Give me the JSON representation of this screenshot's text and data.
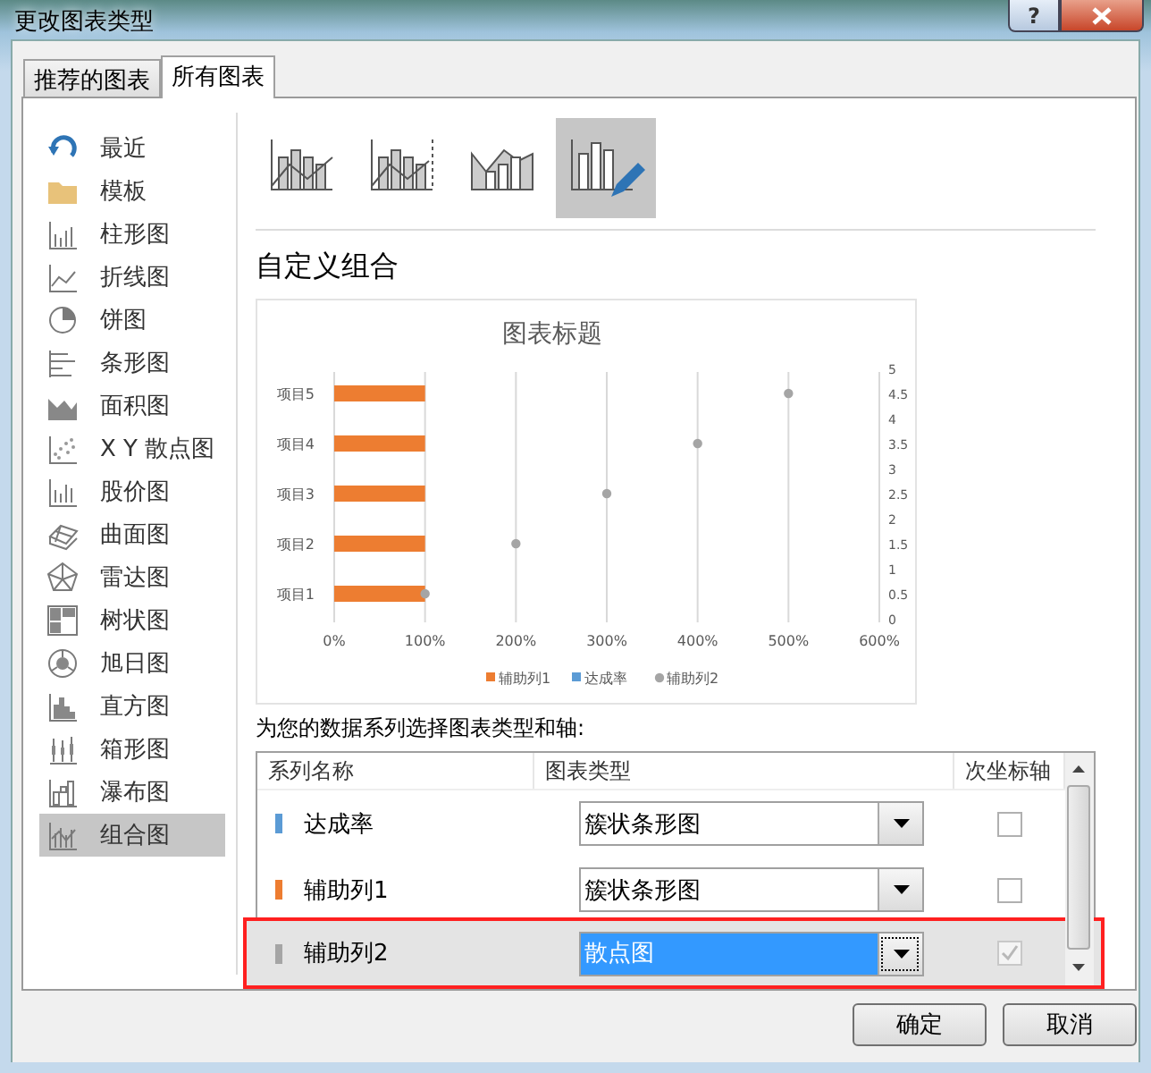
{
  "window": {
    "title": "更改图表类型",
    "help_button": "?"
  },
  "tabs": [
    {
      "label": "推荐的图表",
      "selected": false
    },
    {
      "label": "所有图表",
      "selected": true
    }
  ],
  "sidebar": {
    "items": [
      {
        "label": "最近",
        "selected": false
      },
      {
        "label": "模板",
        "selected": false
      },
      {
        "label": "柱形图",
        "selected": false
      },
      {
        "label": "折线图",
        "selected": false
      },
      {
        "label": "饼图",
        "selected": false
      },
      {
        "label": "条形图",
        "selected": false
      },
      {
        "label": "面积图",
        "selected": false
      },
      {
        "label": "X Y 散点图",
        "selected": false
      },
      {
        "label": "股价图",
        "selected": false
      },
      {
        "label": "曲面图",
        "selected": false
      },
      {
        "label": "雷达图",
        "selected": false
      },
      {
        "label": "树状图",
        "selected": false
      },
      {
        "label": "旭日图",
        "selected": false
      },
      {
        "label": "直方图",
        "selected": false
      },
      {
        "label": "箱形图",
        "selected": false
      },
      {
        "label": "瀑布图",
        "selected": false
      },
      {
        "label": "组合图",
        "selected": true
      }
    ]
  },
  "chart_types": [
    {
      "selected": false
    },
    {
      "selected": false
    },
    {
      "selected": false
    },
    {
      "selected": true
    }
  ],
  "heading": "自定义组合",
  "chart": {
    "chart_data": {
      "type": "bar",
      "orientation": "horizontal",
      "title": "图表标题",
      "categories": [
        "项目5",
        "项目4",
        "项目3",
        "项目2",
        "项目1"
      ],
      "series": [
        {
          "name": "辅助列1",
          "color": "#ed7d31",
          "values": [
            1,
            1,
            1,
            1,
            1
          ]
        },
        {
          "name": "达成率",
          "color": "#5b9bd5",
          "values": [
            0,
            0,
            0,
            0,
            0
          ]
        },
        {
          "name": "辅助列2",
          "color": "#a5a5a5",
          "type": "scatter",
          "values": [
            5,
            4,
            3,
            2,
            1
          ]
        }
      ],
      "xlim": [
        0,
        6
      ],
      "y2lim": [
        0,
        5
      ],
      "grid": {
        "x": true
      },
      "legend": true,
      "xticks": [
        {
          "value": 0,
          "label": "0%"
        },
        {
          "value": 1,
          "label": "100%"
        },
        {
          "value": 2,
          "label": "200%"
        },
        {
          "value": 3,
          "label": "300%"
        },
        {
          "value": 4,
          "label": "400%"
        },
        {
          "value": 5,
          "label": "500%"
        },
        {
          "value": 6,
          "label": "600%"
        }
      ],
      "y2ticks": [
        {
          "value": 0,
          "label": "0"
        },
        {
          "value": 0.5,
          "label": "0.5"
        },
        {
          "value": 1,
          "label": "1"
        },
        {
          "value": 1.5,
          "label": "1.5"
        },
        {
          "value": 2,
          "label": "2"
        },
        {
          "value": 2.5,
          "label": "2.5"
        },
        {
          "value": 3,
          "label": "3"
        },
        {
          "value": 3.5,
          "label": "3.5"
        },
        {
          "value": 4,
          "label": "4"
        },
        {
          "value": 4.5,
          "label": "4.5"
        },
        {
          "value": 5,
          "label": "5"
        }
      ]
    }
  },
  "series_prompt": "为您的数据系列选择图表类型和轴:",
  "series_table": {
    "columns": [
      "系列名称",
      "图表类型",
      "次坐标轴"
    ],
    "rows": [
      {
        "name": "达成率",
        "color": "#5b9bd5",
        "chart_type": "簇状条形图",
        "secondary_axis": false,
        "secondary_disabled": false,
        "selected": false,
        "highlight": false
      },
      {
        "name": "辅助列1",
        "color": "#ed7d31",
        "chart_type": "簇状条形图",
        "secondary_axis": false,
        "secondary_disabled": false,
        "selected": false,
        "highlight": false
      },
      {
        "name": "辅助列2",
        "color": "#a5a5a5",
        "chart_type": "散点图",
        "secondary_axis": true,
        "secondary_disabled": true,
        "selected": true,
        "highlight": true
      }
    ]
  },
  "buttons": [
    "确定",
    "取消"
  ]
}
